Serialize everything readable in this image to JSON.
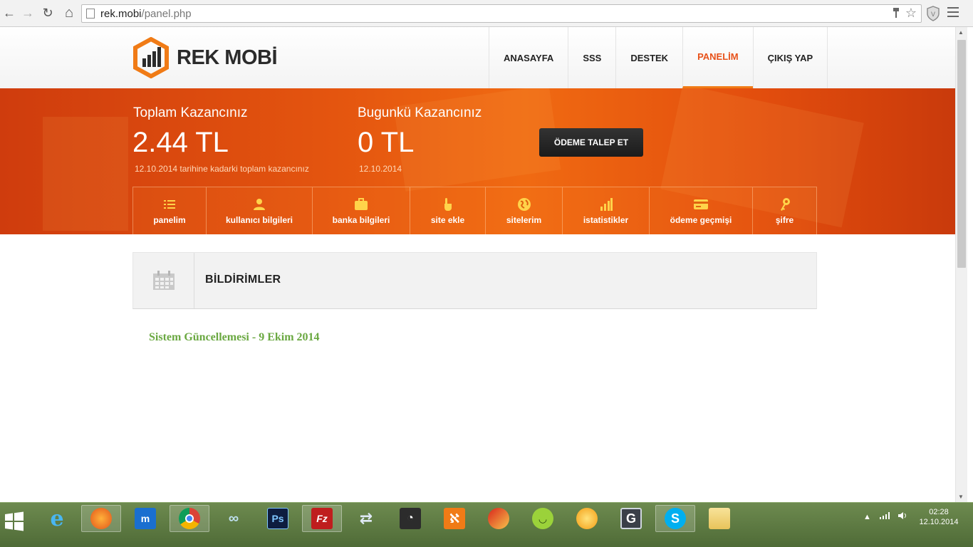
{
  "browser": {
    "url_domain": "rek.mobi",
    "url_path": "/panel.php",
    "back": "←",
    "forward": "→",
    "reload": "↻",
    "home": "⌂",
    "star": "☆"
  },
  "site": {
    "logo_text": "REK MOBİ",
    "nav": [
      {
        "label": "ANASAYFA"
      },
      {
        "label": "SSS"
      },
      {
        "label": "DESTEK"
      },
      {
        "label": "PANELİM"
      },
      {
        "label": "ÇIKIŞ YAP"
      }
    ]
  },
  "earnings": {
    "total_label": "Toplam Kazancınız",
    "total_value": "2.44 TL",
    "total_note": "12.10.2014 tarihine kadarki toplam kazancınız",
    "today_label": "Bugunkü Kazancınız",
    "today_value": "0 TL",
    "today_note": "12.10.2014",
    "pay_button": "ÖDEME TALEP ET"
  },
  "subnav": [
    {
      "label": "panelim",
      "icon": "list-icon"
    },
    {
      "label": "kullanıcı bilgileri",
      "icon": "user-icon"
    },
    {
      "label": "banka bilgileri",
      "icon": "briefcase-icon"
    },
    {
      "label": "site ekle",
      "icon": "pointer-icon"
    },
    {
      "label": "sitelerim",
      "icon": "globe-icon"
    },
    {
      "label": "istatistikler",
      "icon": "bars-icon"
    },
    {
      "label": "ödeme geçmişi",
      "icon": "card-icon"
    },
    {
      "label": "şifre",
      "icon": "key-icon"
    }
  ],
  "notifications": {
    "title": "BİLDİRİMLER",
    "items": [
      {
        "title": "Sistem Güncellemesi - 9 Ekim 2014"
      }
    ]
  },
  "taskbar": {
    "apps": [
      {
        "name": "ie"
      },
      {
        "name": "firefox"
      },
      {
        "name": "maxthon"
      },
      {
        "name": "chrome"
      },
      {
        "name": "app-glasses"
      },
      {
        "name": "photoshop",
        "label": "Ps"
      },
      {
        "name": "filezilla",
        "label": "Fz"
      },
      {
        "name": "network"
      },
      {
        "name": "rss"
      },
      {
        "name": "xampp"
      },
      {
        "name": "ccleaner"
      },
      {
        "name": "app-face"
      },
      {
        "name": "app-orb"
      },
      {
        "name": "app-g",
        "label": "G"
      },
      {
        "name": "skype",
        "label": "S"
      },
      {
        "name": "explorer"
      }
    ],
    "clock_time": "02:28",
    "clock_date": "12.10.2014"
  },
  "colors": {
    "accent": "#f07b16",
    "nav_active": "#e8521a",
    "link_green": "#6aa841"
  }
}
